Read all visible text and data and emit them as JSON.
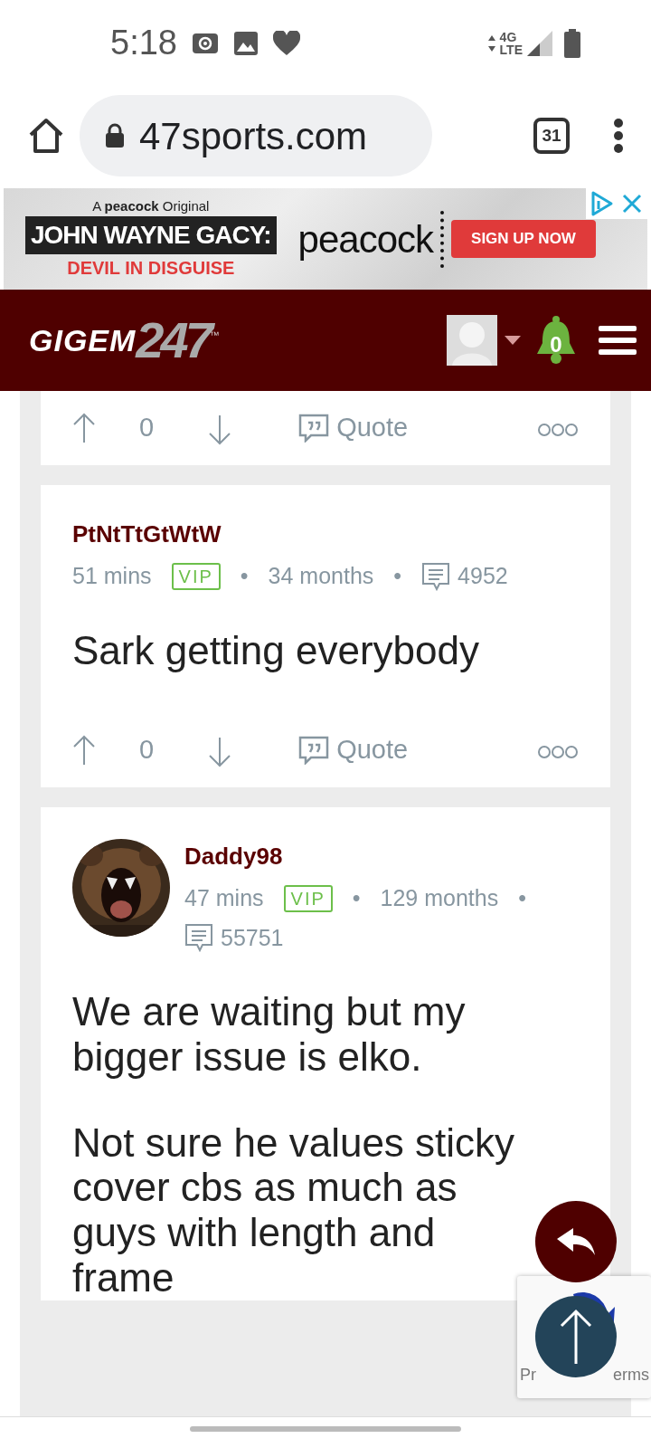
{
  "status_bar": {
    "time": "5:18",
    "network": [
      "4G",
      "LTE"
    ]
  },
  "browser": {
    "url": "47sports.com",
    "tab_count": "31"
  },
  "ad": {
    "kicker": "A **peacock** Original",
    "title": "JOHN WAYNE GACY:",
    "subtitle": "DEVIL IN DISGUISE",
    "brand": "peacock",
    "cta": "SIGN UP NOW"
  },
  "site_header": {
    "logo_word": "GIGEM",
    "logo_number": "247",
    "trademark": "™",
    "notification_count": "0"
  },
  "posts": [
    {
      "kind": "footer",
      "votes": "0",
      "quote_label": "Quote"
    },
    {
      "kind": "full",
      "author": "PtNtTtGtWtW",
      "avatar": false,
      "time": "51 mins",
      "badge": "VIP",
      "separator": "•",
      "tenure": "34 months",
      "comment_count": "4952",
      "body": [
        "Sark getting everybody"
      ],
      "votes": "0",
      "quote_label": "Quote"
    },
    {
      "kind": "full",
      "author": "Daddy98",
      "avatar": true,
      "time": "47 mins",
      "badge": "VIP",
      "separator": "•",
      "tenure": "129 months",
      "comment_count": "55751",
      "body": [
        "We are waiting but my bigger issue is elko.",
        "Not sure he values sticky cover cbs as much as guys with length and frame"
      ]
    }
  ],
  "recaptcha": {
    "text_left": "Pr",
    "text_right": "erms"
  }
}
